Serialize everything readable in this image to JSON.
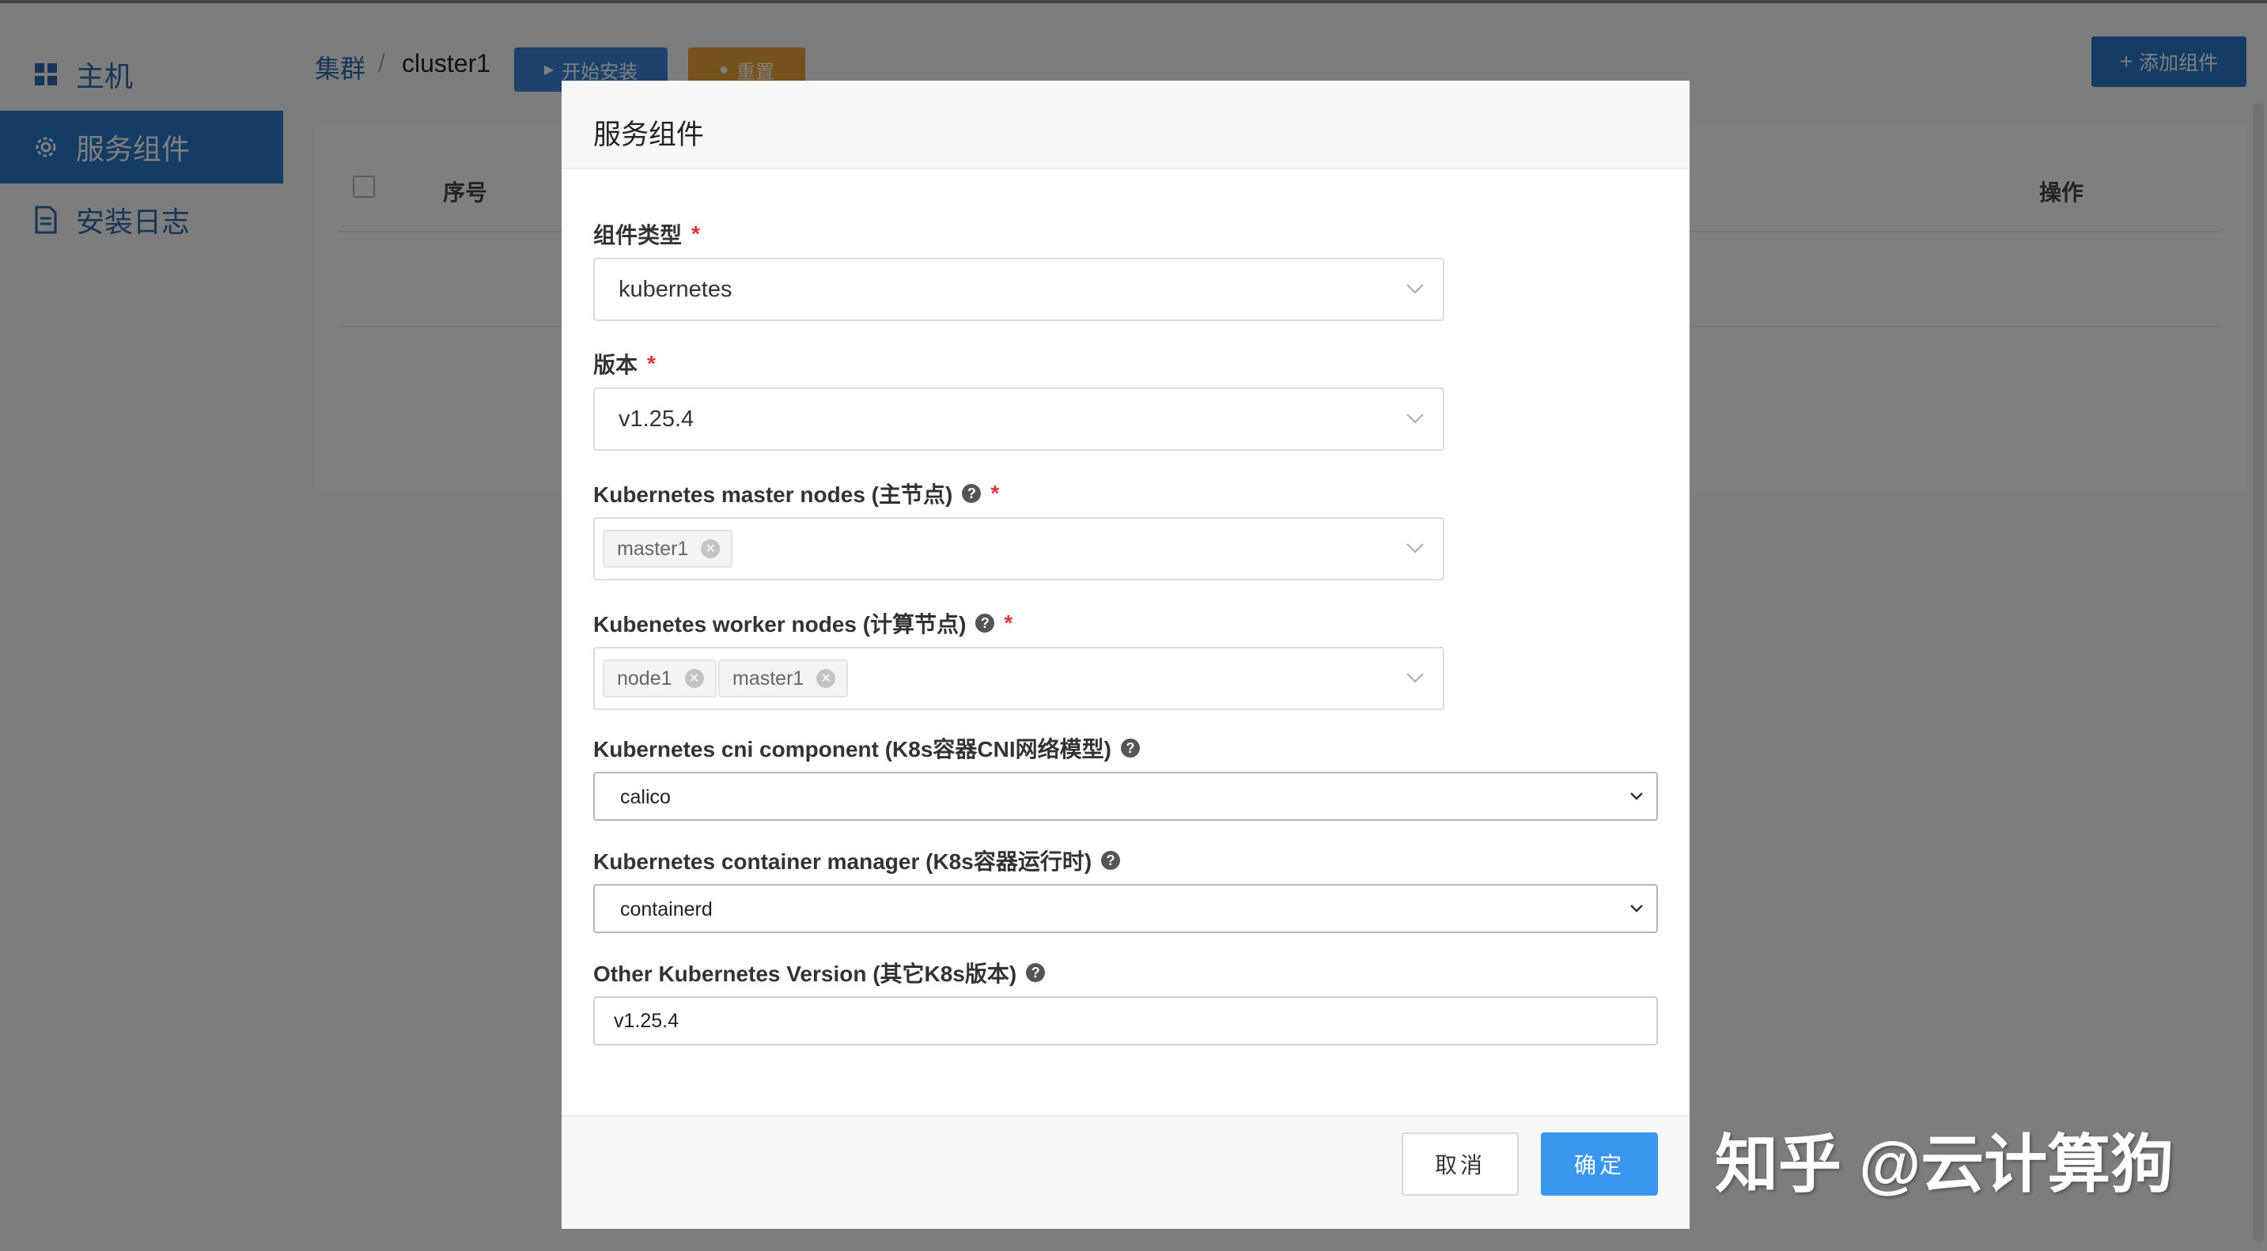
{
  "sidebar": {
    "items": [
      {
        "label": "主机",
        "icon": "grid-icon"
      },
      {
        "label": "服务组件",
        "icon": "gear-icon"
      },
      {
        "label": "安装日志",
        "icon": "document-icon"
      }
    ]
  },
  "header": {
    "breadcrumb_root": "集群",
    "breadcrumb_sep": "/",
    "breadcrumb_current": "cluster1",
    "install_label": "开始安装",
    "reset_label": "重置",
    "add_label": "添加组件"
  },
  "table": {
    "col_seq": "序号",
    "col_op": "操作"
  },
  "modal": {
    "title": "服务组件",
    "component_type": {
      "label": "组件类型",
      "value": "kubernetes"
    },
    "version": {
      "label": "版本",
      "value": "v1.25.4"
    },
    "master_nodes": {
      "label": "Kubernetes master nodes (主节点)",
      "tags": [
        "master1"
      ]
    },
    "worker_nodes": {
      "label": "Kubenetes worker nodes (计算节点)",
      "tags": [
        "node1",
        "master1"
      ]
    },
    "cni": {
      "label": "Kubernetes cni component (K8s容器CNI网络模型)",
      "value": "calico"
    },
    "container_manager": {
      "label": "Kubernetes container manager (K8s容器运行时)",
      "value": "containerd"
    },
    "other_version": {
      "label": "Other Kubernetes Version (其它K8s版本)",
      "value": "v1.25.4"
    },
    "required_mark": "*",
    "help_mark": "?",
    "cancel_label": "取消",
    "ok_label": "确定"
  },
  "watermark": "知乎 @云计算狗",
  "colors": {
    "primary": "#2b78c5",
    "ok_button": "#3a97ee",
    "reset_button": "#e8a33a",
    "required": "#d9363e"
  }
}
